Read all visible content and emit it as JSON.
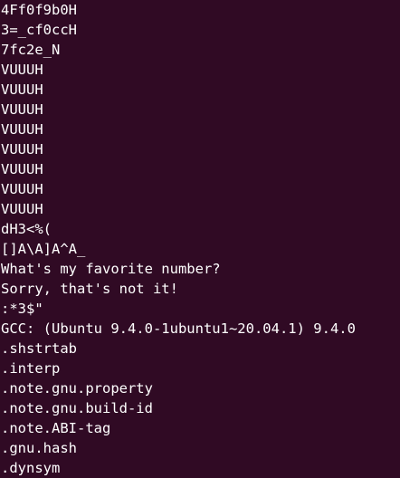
{
  "terminal": {
    "background": "#300a24",
    "foreground": "#ffffff",
    "lines": [
      "4Ff0f9b0H",
      "3=_cf0ccH",
      "7fc2e_N",
      "VUUUH",
      "VUUUH",
      "VUUUH",
      "VUUUH",
      "VUUUH",
      "VUUUH",
      "VUUUH",
      "VUUUH",
      "dH3<%(",
      "[]A\\A]A^A_",
      "What's my favorite number?",
      "Sorry, that's not it!",
      ":*3$\"",
      "GCC: (Ubuntu 9.4.0-1ubuntu1~20.04.1) 9.4.0",
      ".shstrtab",
      ".interp",
      ".note.gnu.property",
      ".note.gnu.build-id",
      ".note.ABI-tag",
      ".gnu.hash",
      ".dynsym"
    ]
  }
}
